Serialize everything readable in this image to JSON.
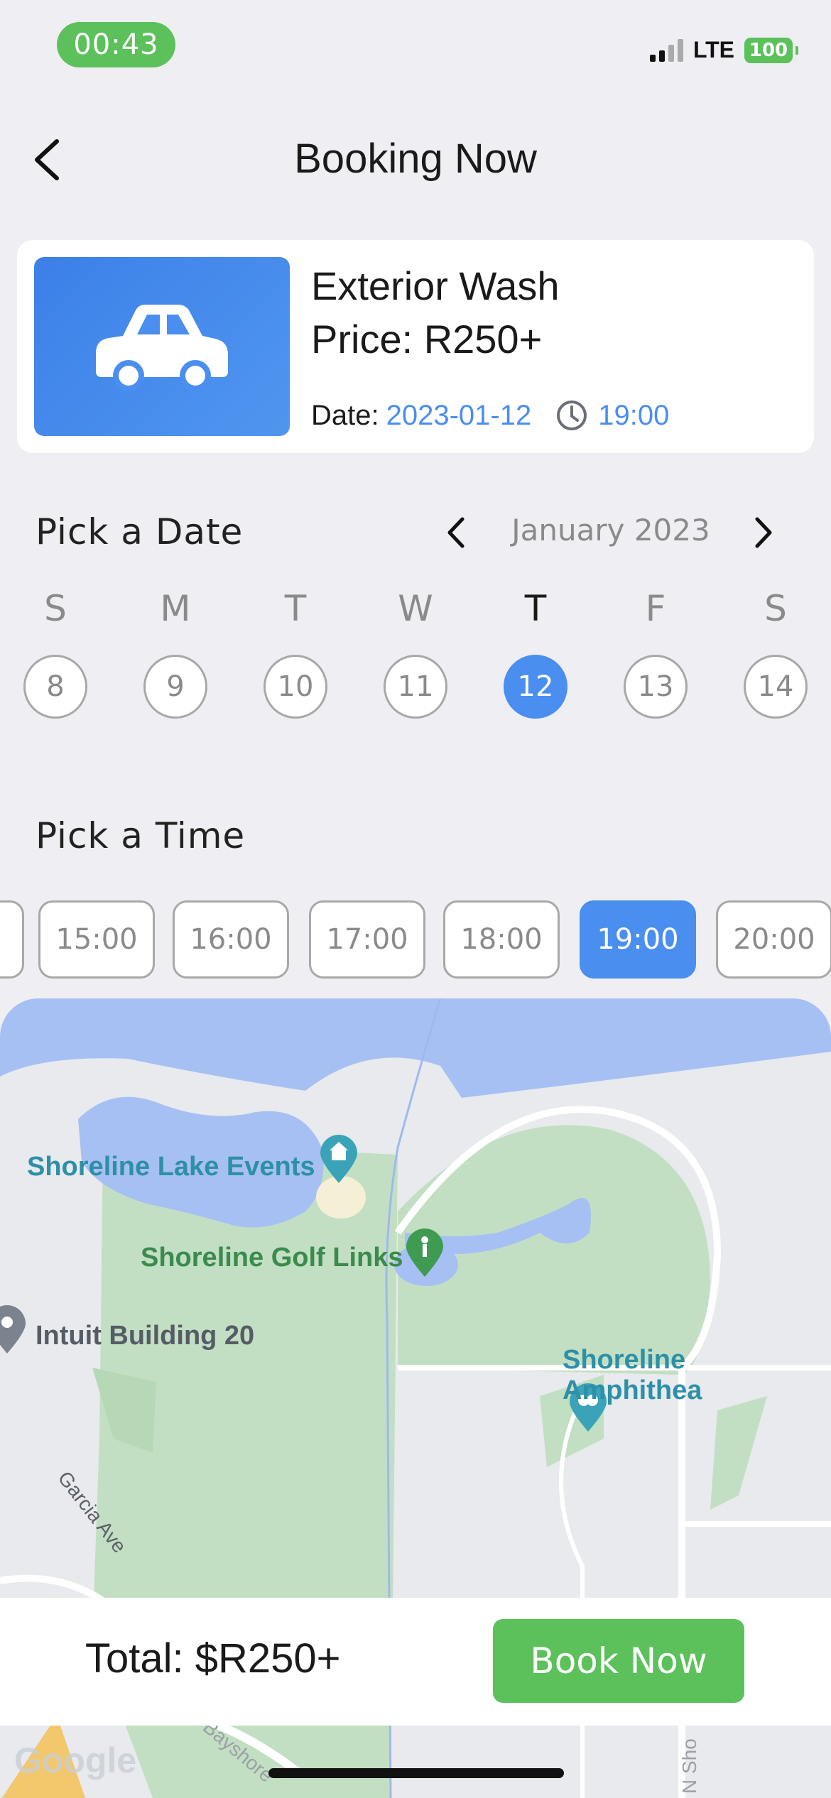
{
  "status_bar": {
    "time": "00:43",
    "network": "LTE",
    "battery": "100"
  },
  "header": {
    "title": "Booking Now",
    "back_icon": "chevron-left-icon"
  },
  "service": {
    "name": "Exterior Wash",
    "price": "Price: R250+",
    "date_label": "Date:",
    "date": "2023-01-12",
    "time": "19:00",
    "icon": "car-icon",
    "tile_color": "#3c80e8"
  },
  "date_picker": {
    "title": "Pick a Date",
    "month": "January 2023",
    "weekdays": [
      "S",
      "M",
      "T",
      "W",
      "T",
      "F",
      "S"
    ],
    "days": [
      "8",
      "9",
      "10",
      "11",
      "12",
      "13",
      "14"
    ],
    "selected_index": 4
  },
  "time_picker": {
    "title": "Pick a Time",
    "slots": [
      "15:00",
      "16:00",
      "17:00",
      "18:00",
      "19:00",
      "20:00"
    ],
    "selected": "19:00"
  },
  "map": {
    "labels": {
      "lake_events": "Shoreline Lake Events",
      "golf_links": "Shoreline Golf Links",
      "intuit": "Intuit Building 20",
      "amphitheatre": "Shoreline Amphithea",
      "garcia": "Garcia Ave",
      "bayshore": "Bayshore",
      "n_sho": "N Sho",
      "google": "Google"
    }
  },
  "footer": {
    "total": "Total: $R250+",
    "book_button": "Book Now"
  },
  "colors": {
    "accent_blue": "#4a8ef0",
    "accent_green": "#5cc15a"
  }
}
